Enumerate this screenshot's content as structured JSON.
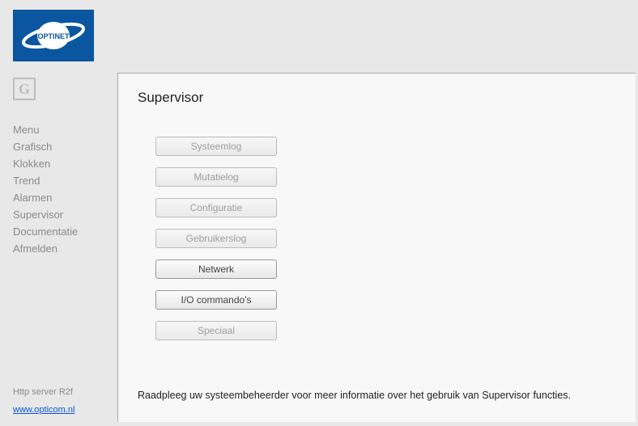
{
  "logo": {
    "text": "OPTINET"
  },
  "g_icon": {
    "letter": "G"
  },
  "nav": {
    "items": [
      {
        "label": "Menu"
      },
      {
        "label": "Grafisch"
      },
      {
        "label": "Klokken"
      },
      {
        "label": "Trend"
      },
      {
        "label": "Alarmen"
      },
      {
        "label": "Supervisor"
      },
      {
        "label": "Documentatie"
      },
      {
        "label": "Afmelden"
      }
    ]
  },
  "footer": {
    "server": "Http server R2f",
    "link_label": "www.opticom.nl",
    "link_href": "http://www.opticom.nl"
  },
  "page": {
    "title": "Supervisor",
    "buttons": [
      {
        "label": "Systeemlog",
        "enabled": false
      },
      {
        "label": "Mutatielog",
        "enabled": false
      },
      {
        "label": "Configuratie",
        "enabled": false
      },
      {
        "label": "Gebruikerslog",
        "enabled": false
      },
      {
        "label": "Netwerk",
        "enabled": true
      },
      {
        "label": "I/O commando's",
        "enabled": true
      },
      {
        "label": "Speciaal",
        "enabled": false
      }
    ],
    "info": "Raadpleeg uw systeembeheerder voor meer informatie over het gebruik van Supervisor functies."
  }
}
